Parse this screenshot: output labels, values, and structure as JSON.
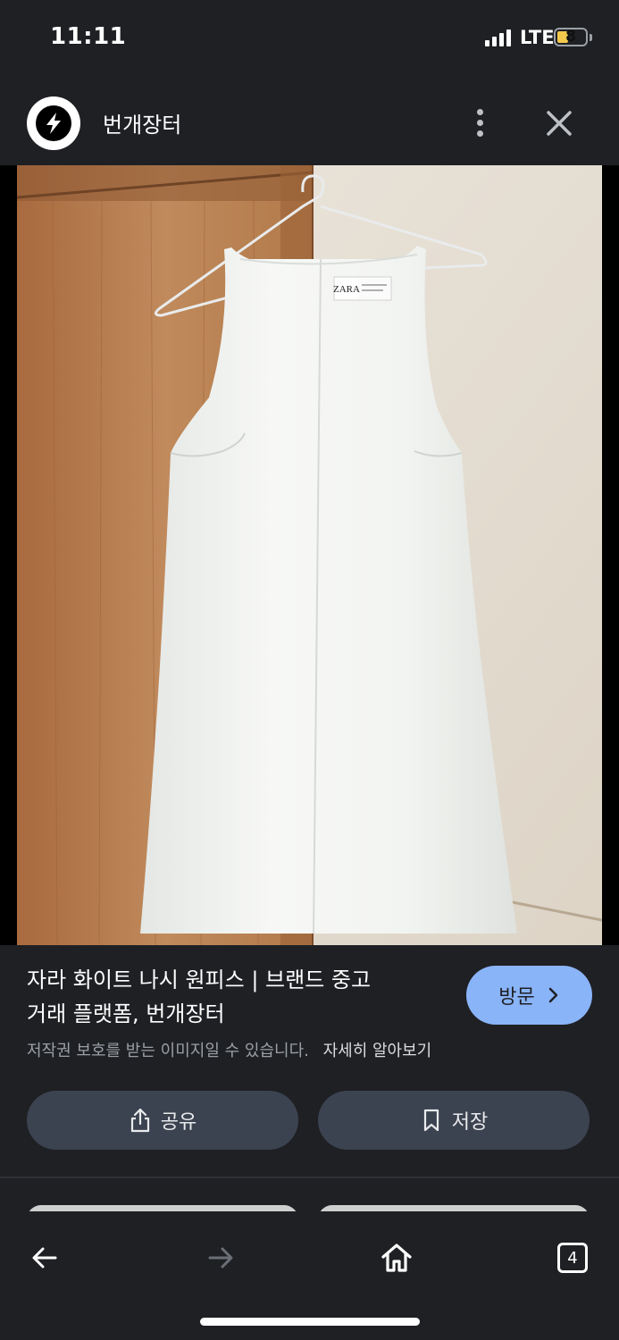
{
  "status_bar": {
    "time": "11:11",
    "network": "LTE",
    "battery": "8"
  },
  "header": {
    "site_name": "번개장터",
    "logo_icon": "lightning-bolt-icon",
    "more_icon": "more-vert-icon",
    "close_icon": "close-icon"
  },
  "image": {
    "alt": "흰색 홀터넥 나시 원피스가 옷걸이에 걸려 있는 사진",
    "tag_text": "ZARA"
  },
  "result": {
    "title": "자라 화이트 나시 원피스 | 브랜드 중고거래 플랫폼, 번개장터",
    "title_line1": "자라 화이트 나시 원피스 | 브랜드 중고",
    "title_line2": "거래 플랫폼, 번개장터",
    "visit_label": "방문",
    "copyright": "저작권 보호를 받는 이미지일 수 있습니다.",
    "learn_more": "자세히 알아보기",
    "share_label": "공유",
    "save_label": "저장"
  },
  "nav": {
    "back_icon": "arrow-left-icon",
    "forward_icon": "arrow-right-icon",
    "home_icon": "home-icon",
    "tab_count": "4"
  },
  "colors": {
    "background": "#1f2024",
    "visit_button": "#8ab4f8",
    "action_button": "#3c4350",
    "battery": "#f2c94c"
  }
}
